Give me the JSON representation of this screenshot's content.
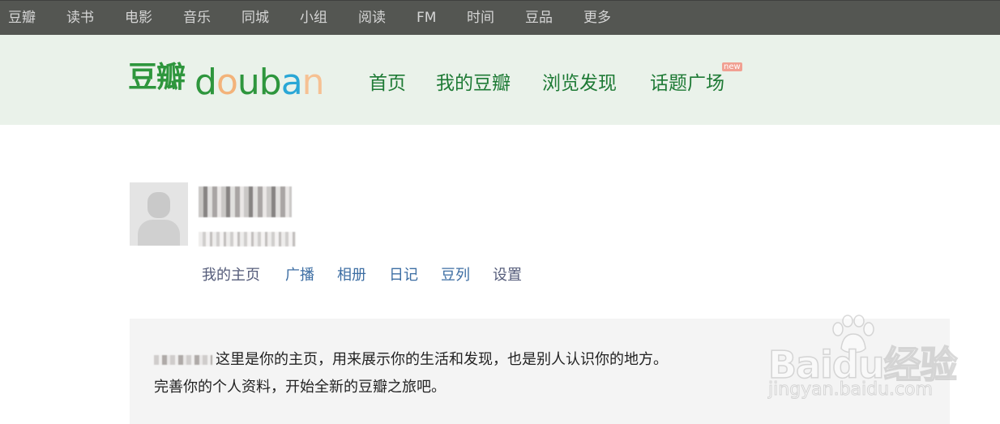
{
  "global_nav": {
    "items": [
      "豆瓣",
      "读书",
      "电影",
      "音乐",
      "同城",
      "小组",
      "阅读",
      "FM",
      "时间",
      "豆品",
      "更多"
    ]
  },
  "header": {
    "logo_cn": "豆瓣",
    "logo_en": "douban",
    "nav": [
      "首页",
      "我的豆瓣",
      "浏览发现",
      "话题广场"
    ],
    "new_badge": "new"
  },
  "profile": {
    "nav": [
      "我的主页",
      "广播",
      "相册",
      "日记",
      "豆列",
      "设置"
    ]
  },
  "intro": {
    "line1": "这里是你的主页，用来展示你的生活和发现，也是别人认识你的地方。",
    "line2": "完善你的个人资料，开始全新的豆瓣之旅吧。"
  },
  "watermark": {
    "brand": "Baidu经验",
    "url": "jingyan.baidu.com"
  },
  "colors": {
    "global_nav_bg": "#545652",
    "header_bg": "#eaf2ea",
    "brand_green": "#2e963d",
    "link_blue": "#3d6ea3",
    "intro_bg": "#f4f4f4"
  }
}
